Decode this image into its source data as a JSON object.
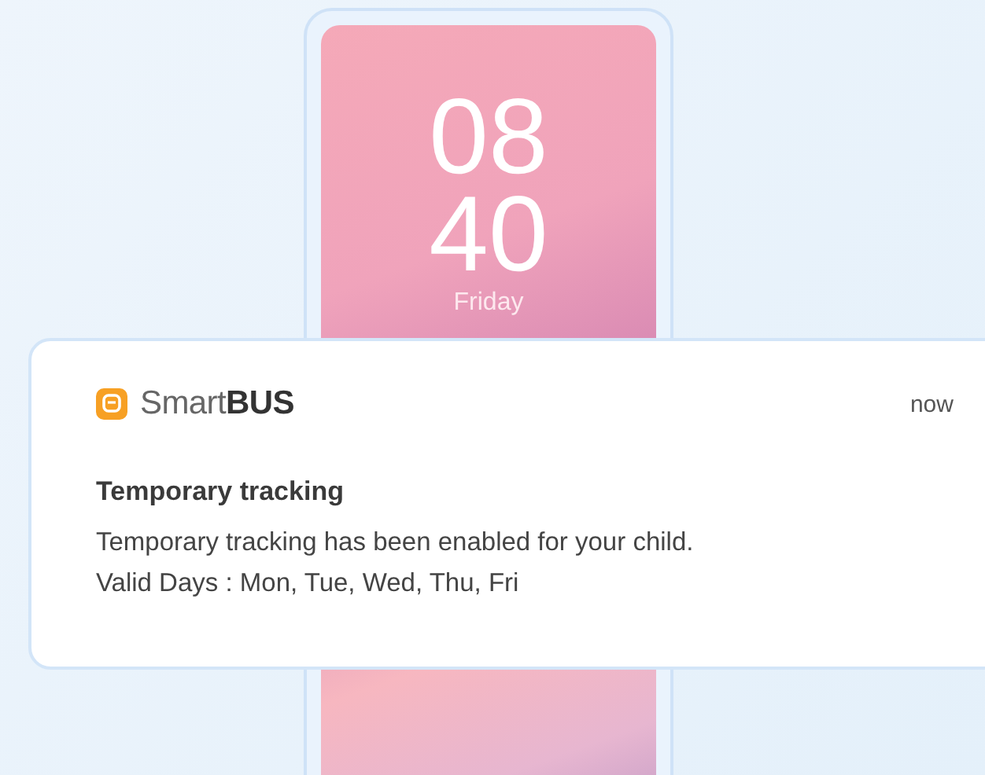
{
  "lock_screen": {
    "hour": "08",
    "minute": "40",
    "day": "Friday"
  },
  "notification": {
    "app_name": "Smart**BUS**",
    "time": "now",
    "title": "Temporary tracking",
    "body": [
      "Temporary tracking has been enabled for your child.",
      "Valid Days : Mon, Tue, Wed, Thu, Fri"
    ]
  }
}
